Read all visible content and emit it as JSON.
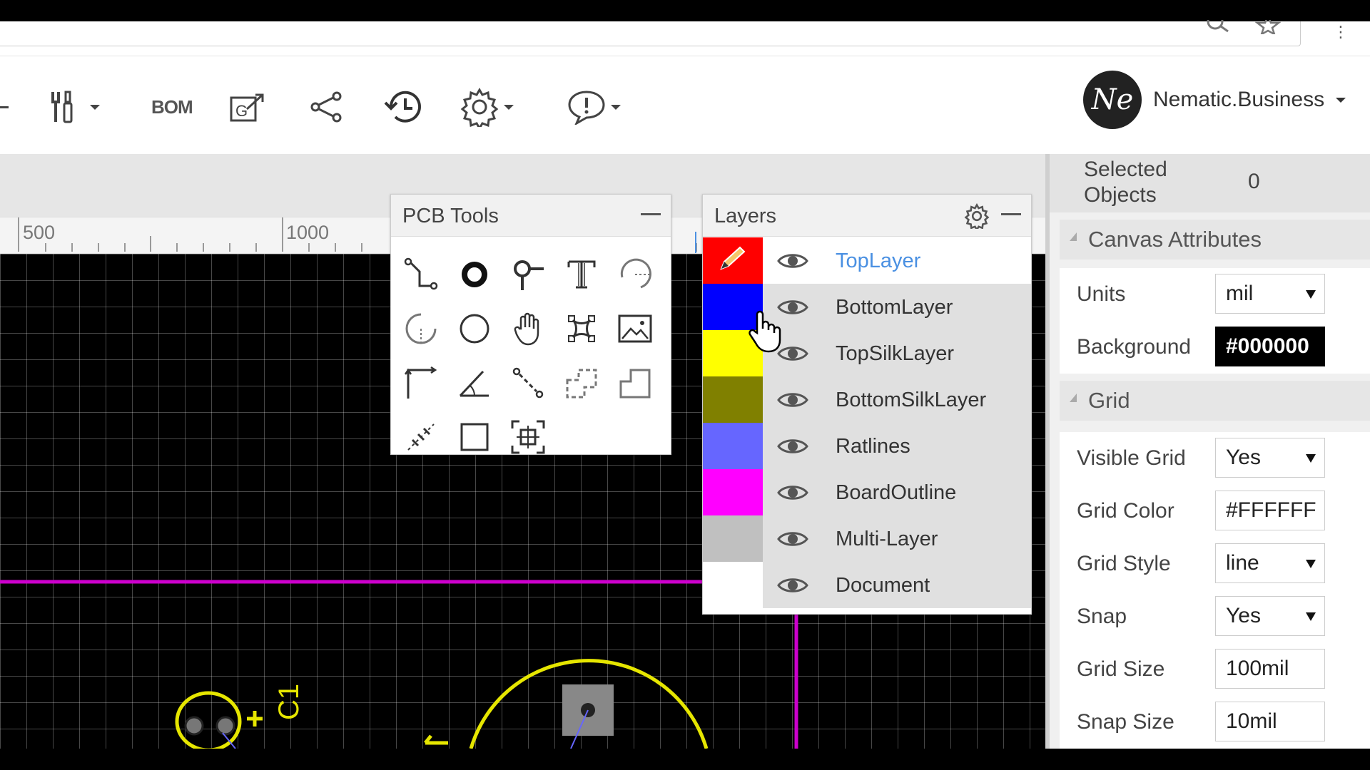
{
  "toolbar": {
    "bom_label": "BOM",
    "buttons": [
      "tools-icon",
      "bom-text",
      "export-icon",
      "share-icon",
      "history-icon",
      "settings-icon",
      "feedback-icon"
    ]
  },
  "user": {
    "avatar_text": "Ne",
    "name": "Nematic.Business"
  },
  "ruler": {
    "labels": [
      "500",
      "1000"
    ]
  },
  "pcb_tools": {
    "title": "PCB Tools",
    "tools": [
      "track-tool-icon",
      "pad-tool-icon",
      "via-tool-icon",
      "text-tool-icon",
      "arc-tool-icon",
      "center-arc-tool-icon",
      "circle-tool-icon",
      "pan-tool-icon",
      "copper-area-tool-icon",
      "image-tool-icon",
      "dimension-tool-icon",
      "protractor-tool-icon",
      "connect-pad-tool-icon",
      "rect-region-tool-icon",
      "solid-region-tool-icon",
      "hole-tool-icon",
      "rectangle-tool-icon",
      "canvas-origin-tool-icon"
    ]
  },
  "layers": {
    "title": "Layers",
    "items": [
      {
        "name": "TopLayer",
        "color": "#FF0000",
        "active": true
      },
      {
        "name": "BottomLayer",
        "color": "#0000FF",
        "active": false
      },
      {
        "name": "TopSilkLayer",
        "color": "#FFFF00",
        "active": false
      },
      {
        "name": "BottomSilkLayer",
        "color": "#808000",
        "active": false
      },
      {
        "name": "Ratlines",
        "color": "#6666FF",
        "active": false
      },
      {
        "name": "BoardOutline",
        "color": "#FF00FF",
        "active": false
      },
      {
        "name": "Multi-Layer",
        "color": "#C0C0C0",
        "active": false
      },
      {
        "name": "Document",
        "color": "#FFFFFF",
        "active": false
      }
    ]
  },
  "properties": {
    "selected_label": "Selected Objects",
    "selected_value": "0",
    "canvas_section": "Canvas Attributes",
    "units_label": "Units",
    "units_value": "mil",
    "background_label": "Background",
    "background_value": "#000000",
    "grid_section": "Grid",
    "visible_grid_label": "Visible Grid",
    "visible_grid_value": "Yes",
    "grid_color_label": "Grid Color",
    "grid_color_value": "#FFFFFF",
    "grid_style_label": "Grid Style",
    "grid_style_value": "line",
    "snap_label": "Snap",
    "snap_value": "Yes",
    "grid_size_label": "Grid Size",
    "grid_size_value": "100mil",
    "snap_size_label": "Snap Size",
    "snap_size_value": "10mil"
  },
  "board": {
    "designator": "C1",
    "pin_label": "1",
    "outline_color": "#CC00CC",
    "silk_color": "#E6E600"
  }
}
